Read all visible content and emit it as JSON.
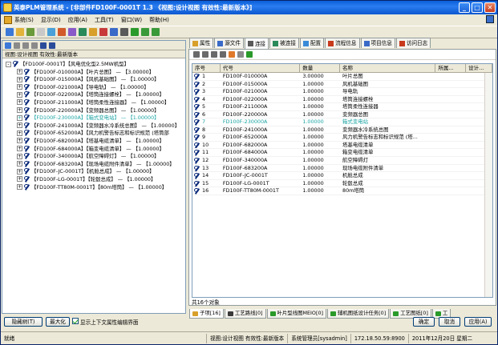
{
  "window": {
    "title": "英泰PLM管理系统 - [非部件FD100F-0001T 1.3 《视图:设计视图 有效性:最新版本》]",
    "min": "_",
    "max": "□",
    "close": "✕"
  },
  "menu": [
    "系统(S)",
    "显示(D)",
    "应用(A)",
    "工具(T)",
    "窗口(W)",
    "帮助(H)"
  ],
  "left": {
    "view_label": "视图:设计视图 有效性:最新版本",
    "tree": [
      {
        "text": "【FD100F-0001T】【风电优化型2.5MW机型】",
        "expander": "-",
        "level": 0,
        "highlight": false
      },
      {
        "text": "【FD100F-010000A】【叶片总图】 — 【3.00000】",
        "expander": "+",
        "level": 1,
        "highlight": false
      },
      {
        "text": "【FD100F-015000A】【风机基础图】 — 【1.00000】",
        "expander": "+",
        "level": 1,
        "highlight": false
      },
      {
        "text": "【FD100F-021000A】【导电轨】 — 【1.00000】",
        "expander": "+",
        "level": 1,
        "highlight": false
      },
      {
        "text": "【FD100F-022000A】【塔筒连接螺栓】 — 【1.00000】",
        "expander": "+",
        "level": 1,
        "highlight": false
      },
      {
        "text": "【FD100F-211000A】【塔筒柔性连接器】 — 【1.00000】",
        "expander": "+",
        "level": 1,
        "highlight": false
      },
      {
        "text": "【FD100F-220000A】【变频器总图】 — 【1.00000】",
        "expander": "+",
        "level": 1,
        "highlight": false
      },
      {
        "text": "【FD100F-230000A】【箱式变电站】 — 【1.00000】",
        "expander": "+",
        "level": 1,
        "highlight": true
      },
      {
        "text": "【FD100F-241000A】【变频器水冷系统总图】 — 【1.00000】",
        "expander": "+",
        "level": 1,
        "highlight": false
      },
      {
        "text": "【FD100F-652000A】【风力机警告标志和标识规范 (塔筒部",
        "expander": "+",
        "level": 1,
        "highlight": false
      },
      {
        "text": "【FD100F-682000A】【塔基电缆清单】 — 【1.00000】",
        "expander": "+",
        "level": 1,
        "highlight": false
      },
      {
        "text": "【FD100F-684000A】【箱变电缆清单】 — 【1.00000】",
        "expander": "+",
        "level": 1,
        "highlight": false
      },
      {
        "text": "【FD100F-340000A】【航空障碍灯】 — 【1.00000】",
        "expander": "+",
        "level": 1,
        "highlight": false
      },
      {
        "text": "【FD100F-683200A】【现场电缆附件清单】 — 【1.00000】",
        "expander": "+",
        "level": 1,
        "highlight": false
      },
      {
        "text": "【FD100F-JC-0001T】【机舱总成】 — 【1.00000】",
        "expander": "+",
        "level": 1,
        "highlight": false
      },
      {
        "text": "【FD100F-LG-0001T】【轮毂总成】 — 【1.00000】",
        "expander": "+",
        "level": 1,
        "highlight": false
      },
      {
        "text": "【FD100F-TT80M-0001T】【80m塔筒】 — 【1.00000】",
        "expander": "+",
        "level": 1,
        "highlight": false
      }
    ]
  },
  "tabs": [
    "属性",
    "源文件",
    "连接",
    "被连接",
    "配置",
    "流程信息",
    "项目信息",
    "访问日志"
  ],
  "active_tab": 2,
  "grid": {
    "headers": [
      "序号",
      "代号",
      "数量",
      "名称",
      "所属...",
      "设计..."
    ],
    "rows": [
      {
        "no": "1",
        "code": "FD100F-010000A",
        "qty": "3.00000",
        "name": "叶片总图",
        "hl": false
      },
      {
        "no": "2",
        "code": "FD100F-015000A",
        "qty": "1.00000",
        "name": "风机基础图",
        "hl": false
      },
      {
        "no": "3",
        "code": "FD100F-021000A",
        "qty": "1.00000",
        "name": "导电轨",
        "hl": false
      },
      {
        "no": "4",
        "code": "FD100F-022000A",
        "qty": "1.00000",
        "name": "塔筒连接螺栓",
        "hl": false
      },
      {
        "no": "5",
        "code": "FD100F-211000A",
        "qty": "1.00000",
        "name": "塔筒柔性连接器",
        "hl": false
      },
      {
        "no": "6",
        "code": "FD100F-220000A",
        "qty": "1.00000",
        "name": "变频器总图",
        "hl": false
      },
      {
        "no": "7",
        "code": "FD100F-230000A",
        "qty": "1.00000",
        "name": "箱式变电站",
        "hl": true
      },
      {
        "no": "8",
        "code": "FD100F-241000A",
        "qty": "1.00000",
        "name": "变频器水冷系统总图",
        "hl": false
      },
      {
        "no": "9",
        "code": "FD100F-652000A",
        "qty": "1.00000",
        "name": "风力机警告标志和标识规范 (塔...",
        "hl": false
      },
      {
        "no": "10",
        "code": "FD100F-682000A",
        "qty": "1.00000",
        "name": "塔基电缆清单",
        "hl": false
      },
      {
        "no": "11",
        "code": "FD100F-684000A",
        "qty": "1.00000",
        "name": "箱变电缆清单",
        "hl": false
      },
      {
        "no": "12",
        "code": "FD100F-340000A",
        "qty": "1.00000",
        "name": "航空障碍灯",
        "hl": false
      },
      {
        "no": "13",
        "code": "FD100F-683200A",
        "qty": "1.00000",
        "name": "现场电缆附件清单",
        "hl": false
      },
      {
        "no": "14",
        "code": "FD100F-JC-0001T",
        "qty": "1.00000",
        "name": "机舱总成",
        "hl": false
      },
      {
        "no": "15",
        "code": "FD100F-LG-0001T",
        "qty": "1.00000",
        "name": "轮毂总成",
        "hl": false
      },
      {
        "no": "16",
        "code": "FD100F-TT80M-0001T",
        "qty": "1.00000",
        "name": "80m塔筒",
        "hl": false
      }
    ],
    "count_text": "共16个对象"
  },
  "bottom_tabs": [
    "子项[16]",
    "工艺路线[0]",
    "叶片型线图MEIO[0]",
    "辅机图纸设计任务[0]",
    "工艺图纸[0]",
    "工"
  ],
  "buttons": {
    "hide_tree": "隐藏树(T)",
    "maximize": "最大化",
    "show_upper": "显示上下文属性编辑界面",
    "confirm": "确定",
    "cancel": "取消",
    "apply": "应用(A)"
  },
  "status": {
    "ready": "就绪",
    "view": "视图:设计视图 有效性:最新版本",
    "user": "系统管理员[sysadmin]",
    "ip": "172.18.50.59:8900",
    "date": "2011年12月20日 星期二"
  },
  "colors": {
    "title_blue": "#0b57d0",
    "highlight_teal": "#1aa3a3",
    "tab_icon_red": "#c83a1c"
  }
}
